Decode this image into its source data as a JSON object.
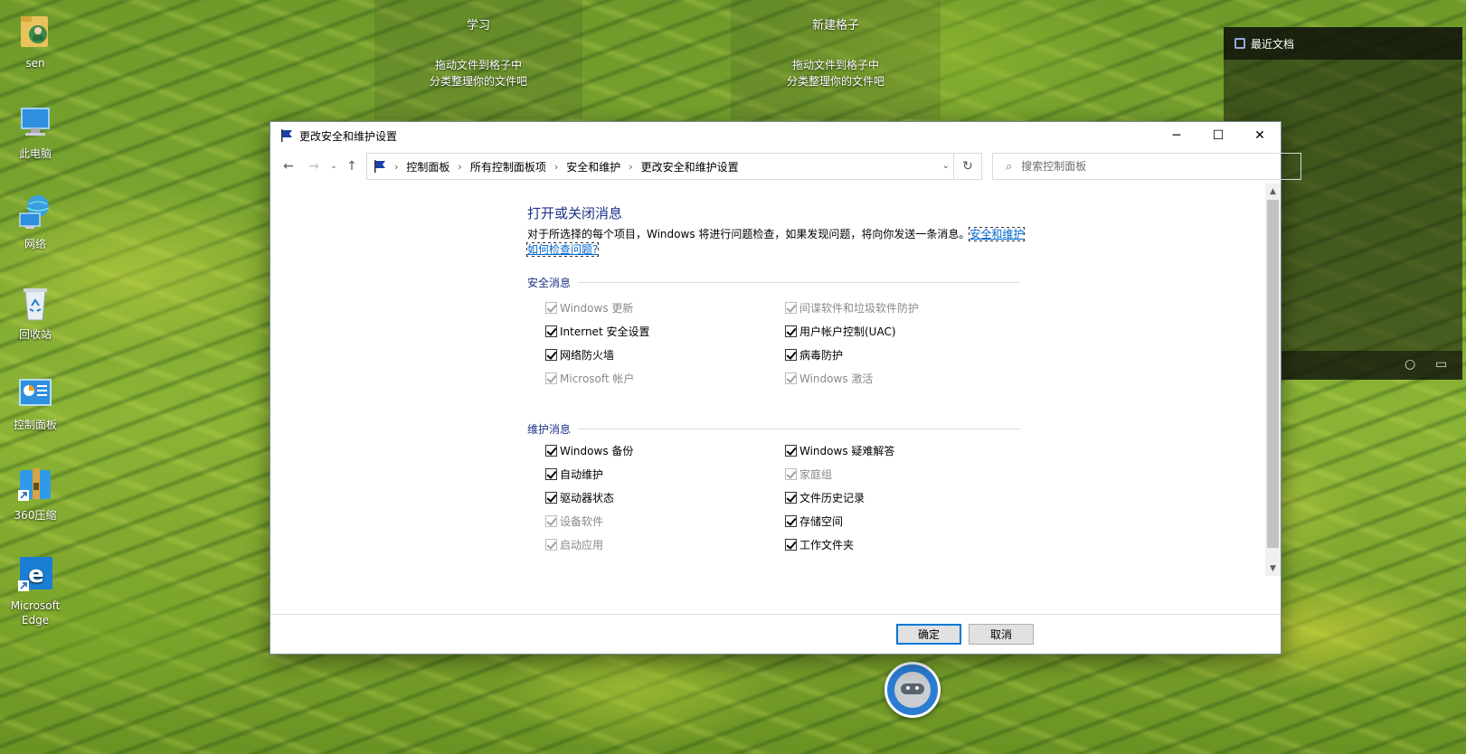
{
  "desktop": {
    "icons": [
      {
        "label": "sen",
        "icon": "user-folder-icon"
      },
      {
        "label": "此电脑",
        "icon": "computer-icon"
      },
      {
        "label": "网络",
        "icon": "network-icon"
      },
      {
        "label": "回收站",
        "icon": "recycle-bin-icon"
      },
      {
        "label": "控制面板",
        "icon": "control-panel-icon"
      },
      {
        "label": "360压缩",
        "icon": "zip-icon"
      },
      {
        "label": "Microsoft Edge",
        "icon": "edge-icon"
      }
    ],
    "fences": [
      {
        "title": "学习",
        "desc1": "拖动文件到格子中",
        "desc2": "分类整理你的文件吧"
      },
      {
        "title": "新建格子",
        "desc1": "拖动文件到格子中",
        "desc2": "分类整理你的文件吧"
      }
    ],
    "recent_docs": {
      "title": "最近文档"
    }
  },
  "window": {
    "title": "更改安全和维护设置",
    "breadcrumb": [
      "控制面板",
      "所有控制面板项",
      "安全和维护",
      "更改安全和维护设置"
    ],
    "search_placeholder": "搜索控制面板",
    "heading": "打开或关闭消息",
    "description": "对于所选择的每个项目，Windows 将进行问题检查，如果发现问题，将向你发送一条消息。",
    "link": "安全和维护如何检查问题?",
    "security_section": "安全消息",
    "security_items": [
      {
        "label": "Windows 更新",
        "checked": true,
        "enabled": false
      },
      {
        "label": "间谍软件和垃圾软件防护",
        "checked": true,
        "enabled": false
      },
      {
        "label": "Internet 安全设置",
        "checked": true,
        "enabled": true
      },
      {
        "label": "用户帐户控制(UAC)",
        "checked": true,
        "enabled": true
      },
      {
        "label": "网络防火墙",
        "checked": true,
        "enabled": true
      },
      {
        "label": "病毒防护",
        "checked": true,
        "enabled": true
      },
      {
        "label": "Microsoft 帐户",
        "checked": true,
        "enabled": false
      },
      {
        "label": "Windows 激活",
        "checked": true,
        "enabled": false
      }
    ],
    "maintenance_section": "维护消息",
    "maintenance_items": [
      {
        "label": "Windows 备份",
        "checked": true,
        "enabled": true
      },
      {
        "label": "Windows 疑难解答",
        "checked": true,
        "enabled": true
      },
      {
        "label": "自动维护",
        "checked": true,
        "enabled": true
      },
      {
        "label": "家庭组",
        "checked": true,
        "enabled": false
      },
      {
        "label": "驱动器状态",
        "checked": true,
        "enabled": true
      },
      {
        "label": "文件历史记录",
        "checked": true,
        "enabled": true
      },
      {
        "label": "设备软件",
        "checked": true,
        "enabled": false
      },
      {
        "label": "存储空间",
        "checked": true,
        "enabled": true
      },
      {
        "label": "启动应用",
        "checked": true,
        "enabled": false
      },
      {
        "label": "工作文件夹",
        "checked": true,
        "enabled": true
      }
    ],
    "ok_label": "确定",
    "cancel_label": "取消"
  }
}
